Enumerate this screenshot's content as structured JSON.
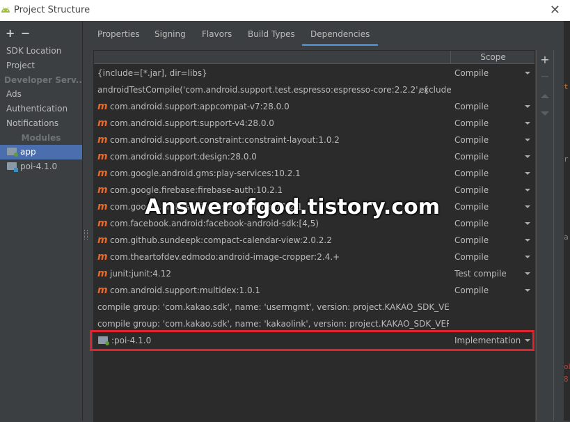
{
  "window": {
    "title": "Project Structure",
    "close_label": "✕"
  },
  "sidebar": {
    "add_label": "+",
    "remove_label": "−",
    "items": [
      {
        "label": "SDK Location"
      },
      {
        "label": "Project"
      },
      {
        "label": "Developer Serv..."
      },
      {
        "label": "Ads"
      },
      {
        "label": "Authentication"
      },
      {
        "label": "Notifications"
      },
      {
        "label": "Modules"
      },
      {
        "label": "app"
      },
      {
        "label": "poi-4.1.0"
      }
    ]
  },
  "tabs": [
    {
      "label": "Properties"
    },
    {
      "label": "Signing"
    },
    {
      "label": "Flavors"
    },
    {
      "label": "Build Types"
    },
    {
      "label": "Dependencies"
    }
  ],
  "table": {
    "scope_header": "Scope",
    "rows": [
      {
        "name": "{include=[*.jar], dir=libs}",
        "scope": "Compile",
        "icon": "none"
      },
      {
        "name": "androidTestCompile('com.android.support.test.espresso:espresso-core:2.2.2', {",
        "scope": "",
        "extra": "exclude",
        "icon": "none"
      },
      {
        "name": "com.android.support:appcompat-v7:28.0.0",
        "scope": "Compile",
        "icon": "maven-icon"
      },
      {
        "name": "com.android.support:support-v4:28.0.0",
        "scope": "Compile",
        "icon": "maven-icon"
      },
      {
        "name": "com.android.support.constraint:constraint-layout:1.0.2",
        "scope": "Compile",
        "icon": "maven-icon"
      },
      {
        "name": "com.android.support:design:28.0.0",
        "scope": "Compile",
        "icon": "maven-icon"
      },
      {
        "name": "com.google.android.gms:play-services:10.2.1",
        "scope": "Compile",
        "icon": "maven-icon"
      },
      {
        "name": "com.google.firebase:firebase-auth:10.2.1",
        "scope": "Compile",
        "icon": "maven-icon"
      },
      {
        "name": "com.google.firebase:firebase-database:10.2.1",
        "scope": "Compile",
        "icon": "maven-icon"
      },
      {
        "name": "com.facebook.android:facebook-android-sdk:[4,5)",
        "scope": "Compile",
        "icon": "maven-icon"
      },
      {
        "name": "com.github.sundeepk:compact-calendar-view:2.0.2.2",
        "scope": "Compile",
        "icon": "maven-icon"
      },
      {
        "name": "com.theartofdev.edmodo:android-image-cropper:2.4.+",
        "scope": "Compile",
        "icon": "maven-icon"
      },
      {
        "name": "junit:junit:4.12",
        "scope": "Test compile",
        "icon": "maven-icon"
      },
      {
        "name": "com.android.support:multidex:1.0.1",
        "scope": "Compile",
        "icon": "maven-icon"
      },
      {
        "name": "compile group: 'com.kakao.sdk', name: 'usermgmt', version: project.KAKAO_SDK_VERSION",
        "scope": "",
        "icon": "none"
      },
      {
        "name": "compile group: 'com.kakao.sdk', name: 'kakaolink', version: project.KAKAO_SDK_VERSION",
        "scope": "",
        "icon": "none"
      },
      {
        "name": ":poi-4.1.0",
        "scope": "Implementation",
        "icon": "module-icon"
      }
    ]
  },
  "right_tools": {
    "add_label": "+",
    "remove_label": "−"
  },
  "editor_strip": {
    "chars": [
      "t",
      "r",
      "a",
      "ob",
      "8"
    ]
  },
  "watermark": "Answerofgod.tistory.com",
  "colors": {
    "selection": "#4b6eaf",
    "tab_underline": "#4a88c7",
    "maven_icon": "#e8692d",
    "highlight_border": "#e0242d"
  }
}
